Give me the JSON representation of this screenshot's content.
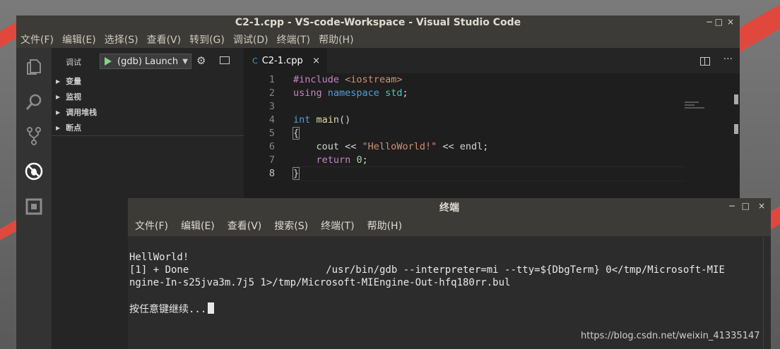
{
  "vscode": {
    "title": "C2-1.cpp - VS-code-Workspace - Visual Studio Code",
    "window_controls": {
      "minimize": "−",
      "maximize": "□",
      "close": "×"
    },
    "menu": [
      "文件(F)",
      "编辑(E)",
      "选择(S)",
      "查看(V)",
      "转到(G)",
      "调试(D)",
      "终端(T)",
      "帮助(H)"
    ],
    "debug": {
      "label": "调试",
      "config": "(gdb) Launch",
      "sections": [
        "变量",
        "监视",
        "调用堆栈",
        "断点"
      ]
    },
    "tab": {
      "icon": "C",
      "name": "C2-1.cpp",
      "close": "×"
    },
    "more": "···",
    "line_numbers": [
      "1",
      "2",
      "3",
      "4",
      "5",
      "6",
      "7",
      "8"
    ],
    "code": {
      "l1_pp": "#include",
      "l1_hdr": "<iostream>",
      "l2_using": "using",
      "l2_namespace": "namespace",
      "l2_std": "std",
      "l2_semi": ";",
      "l4_int": "int",
      "l4_main": "main",
      "l4_paren": "()",
      "l5_brace": "{",
      "l6_cout": "cout << ",
      "l6_str": "\"HelloWorld!\"",
      "l6_rest": " << endl;",
      "l7_return": "return",
      "l7_zero": "0",
      "l7_semi": ";",
      "l8_brace": "}"
    }
  },
  "terminal": {
    "title": "终端",
    "window_controls": {
      "minimize": "−",
      "maximize": "□",
      "close": "×"
    },
    "menu": [
      "文件(F)",
      "编辑(E)",
      "查看(V)",
      "搜索(S)",
      "终端(T)",
      "帮助(H)"
    ],
    "lines": [
      "HellWorld!",
      "[1] + Done                       /usr/bin/gdb --interpreter=mi --tty=${DbgTerm} 0</tmp/Microsoft-MIE",
      "ngine-In-s25jva3m.7j5 1>/tmp/Microsoft-MIEngine-Out-hfq180rr.bul",
      "",
      "按任意键继续..."
    ]
  },
  "watermark": "https://blog.csdn.net/weixin_41335147"
}
